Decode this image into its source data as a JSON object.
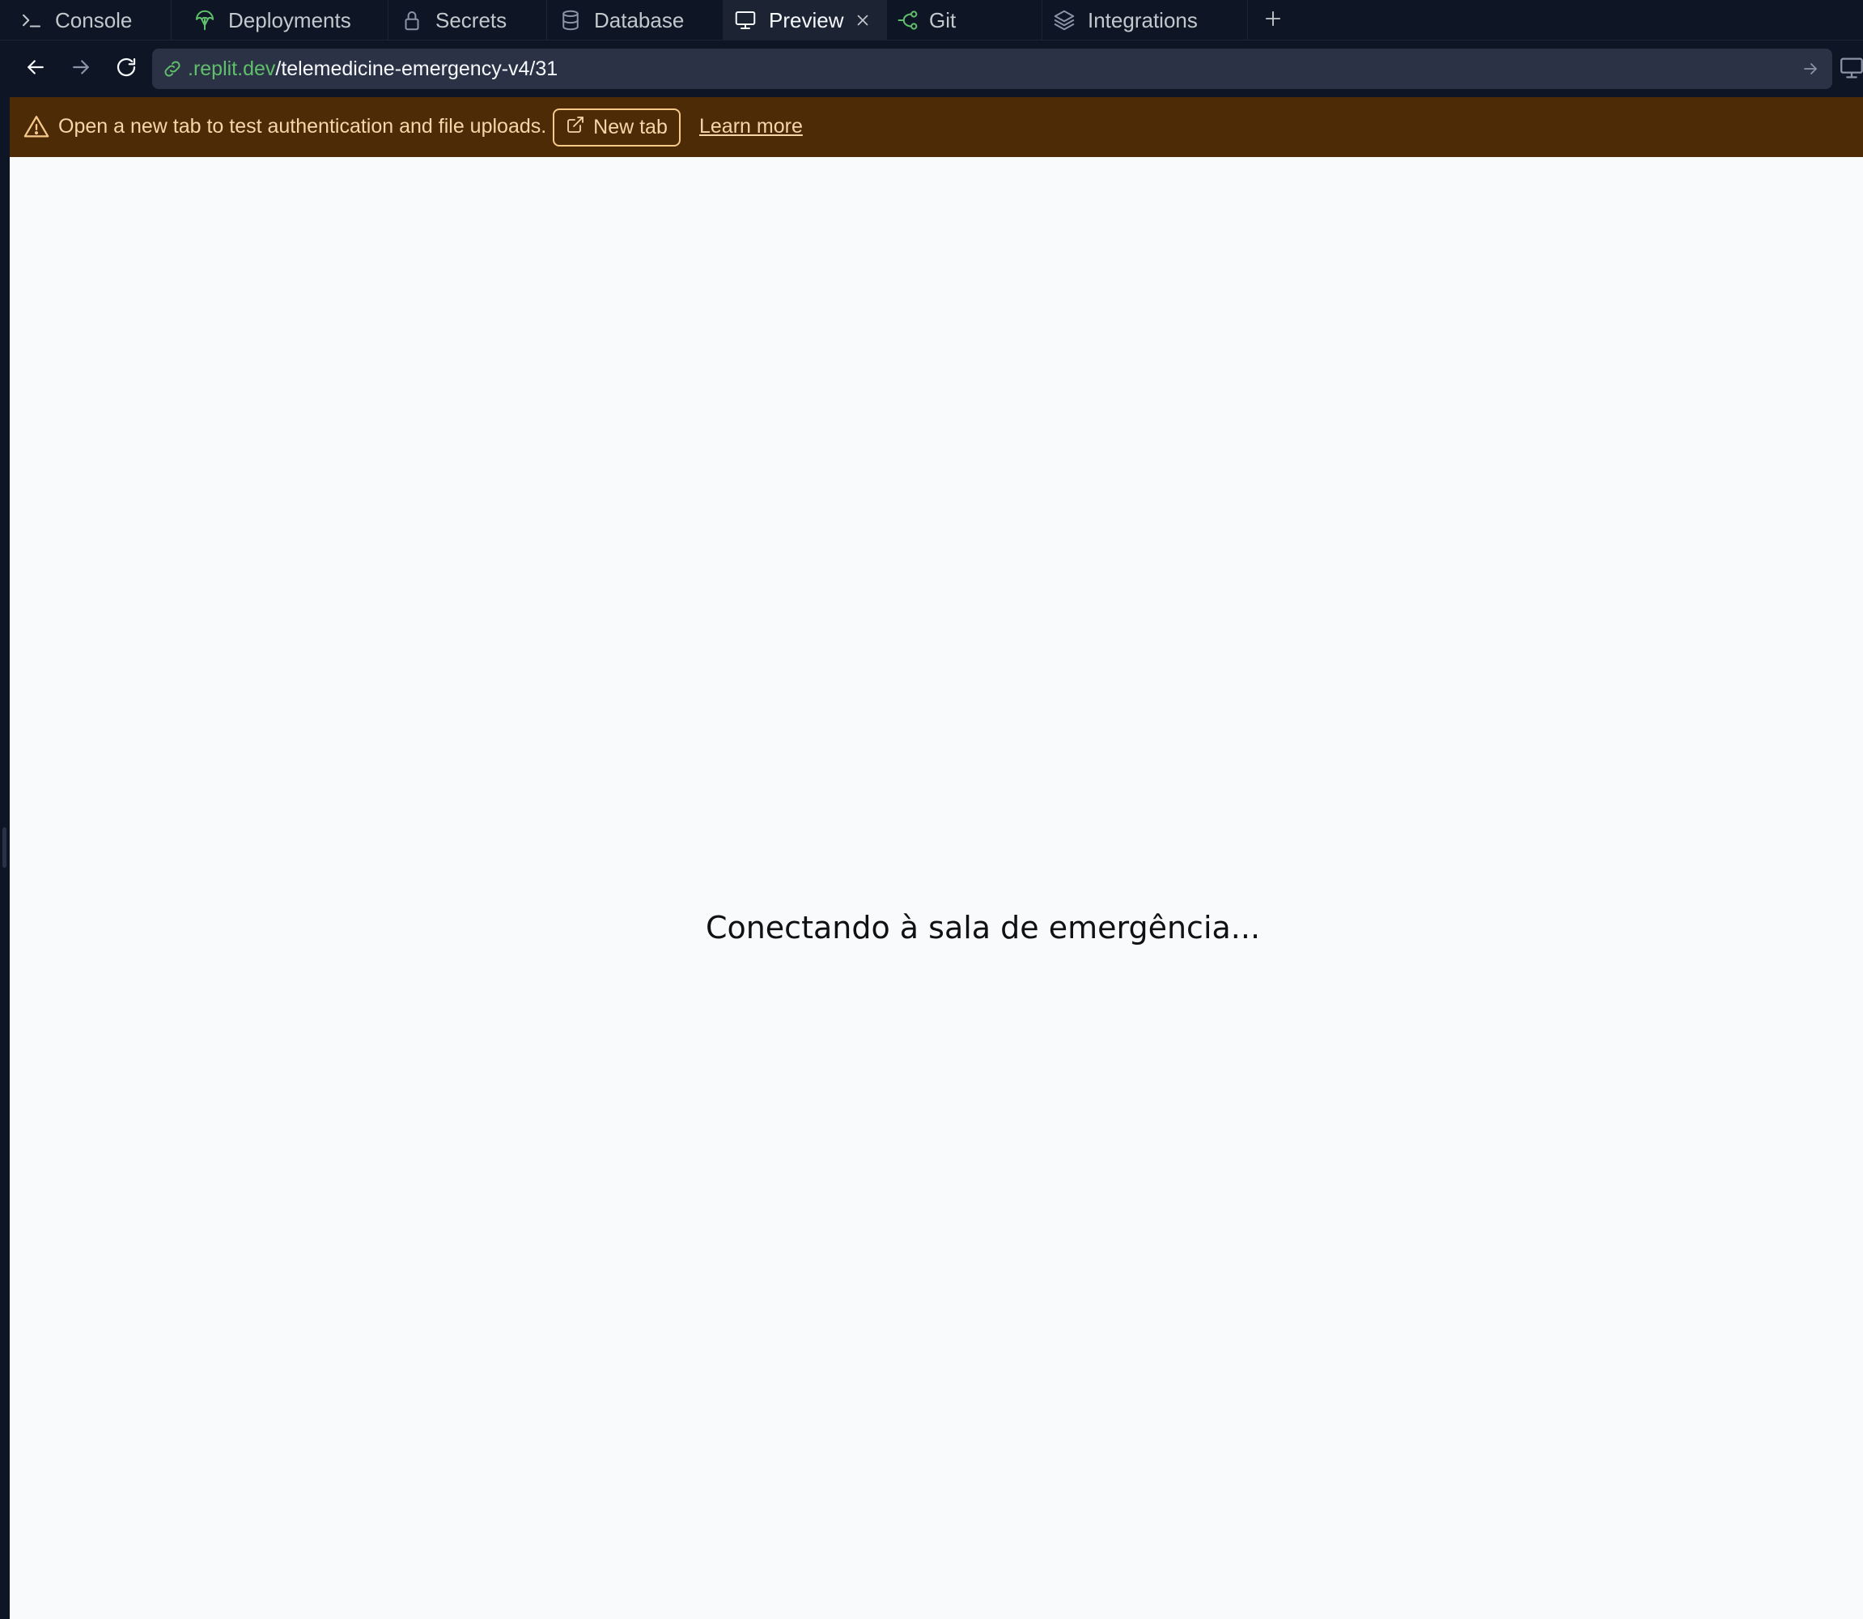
{
  "tabs": [
    {
      "label": "Console",
      "icon": "console-icon"
    },
    {
      "label": "Deployments",
      "icon": "deployments-icon"
    },
    {
      "label": "Secrets",
      "icon": "lock-icon"
    },
    {
      "label": "Database",
      "icon": "database-icon"
    },
    {
      "label": "Preview",
      "icon": "monitor-icon",
      "active": true
    },
    {
      "label": "Git",
      "icon": "git-icon"
    },
    {
      "label": "Integrations",
      "icon": "layers-icon"
    }
  ],
  "address_bar": {
    "url_domain": ".replit.dev",
    "url_path": "/telemedicine-emergency-v4/31"
  },
  "banner": {
    "message": "Open a new tab to test authentication and file uploads.",
    "new_tab_label": "New tab",
    "learn_more_label": "Learn more"
  },
  "preview": {
    "status_text": "Conectando à sala de emergência..."
  },
  "colors": {
    "background": "#0e1525",
    "active_tab": "#1c2333",
    "url_field": "#2b3245",
    "domain_green": "#5fbf6b",
    "banner_bg": "#4d2b06",
    "banner_text": "#f6d6a8",
    "preview_bg": "#f8fafc"
  }
}
